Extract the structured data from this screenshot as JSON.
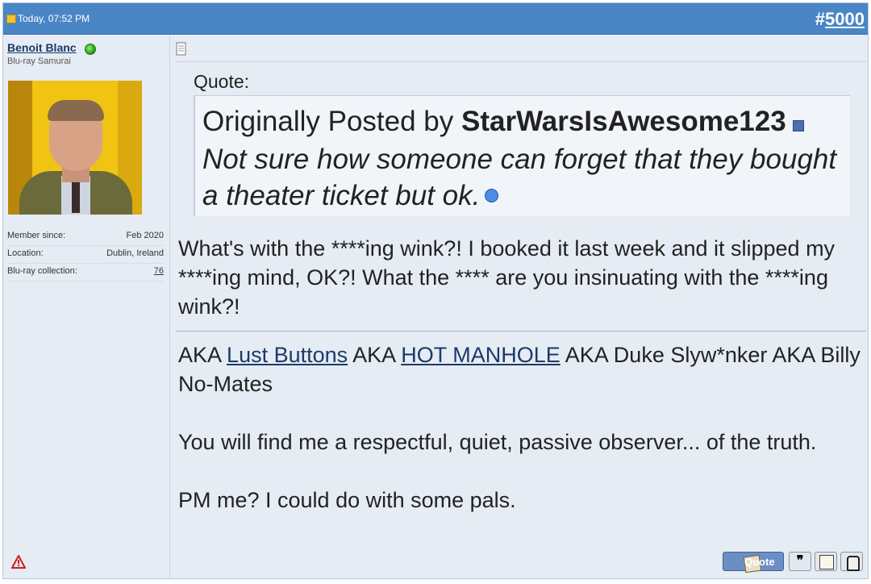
{
  "header": {
    "date": "Today, 07:52 PM",
    "post_number_prefix": "#",
    "post_number": "5000"
  },
  "user": {
    "name": "Benoit Blanc",
    "title": "Blu-ray Samurai",
    "meta": [
      {
        "label": "Member since:",
        "value": "Feb 2020"
      },
      {
        "label": "Location:",
        "value": "Dublin, Ireland"
      },
      {
        "label": "Blu-ray collection:",
        "value": "76"
      }
    ]
  },
  "post": {
    "quote_label": "Quote:",
    "quote_prefix": "Originally Posted by ",
    "quote_author": "StarWarsIsAwesome123",
    "quote_text": "Not sure how someone can forget that they bought a theater ticket but ok.",
    "reply": "What's with the ****ing wink?! I booked it last week and it slipped my ****ing mind, OK?! What the **** are you insinuating with the ****ing wink?!"
  },
  "signature": {
    "aka1": "AKA ",
    "link1": "Lust Buttons",
    "aka2": " AKA ",
    "link2": "HOT MANHOLE",
    "aka3": " AKA Duke Slyw*nker AKA Billy No-Mates",
    "line2": "You will find me a respectful, quiet, passive observer... of the truth.",
    "line3": "PM me? I could do with some pals."
  },
  "buttons": {
    "quote": "Quote",
    "multiquote_glyph": "❞"
  },
  "colors": {
    "header_bg": "#4a86c6",
    "post_bg": "#e6ecf3",
    "link": "#1b3a6c"
  }
}
